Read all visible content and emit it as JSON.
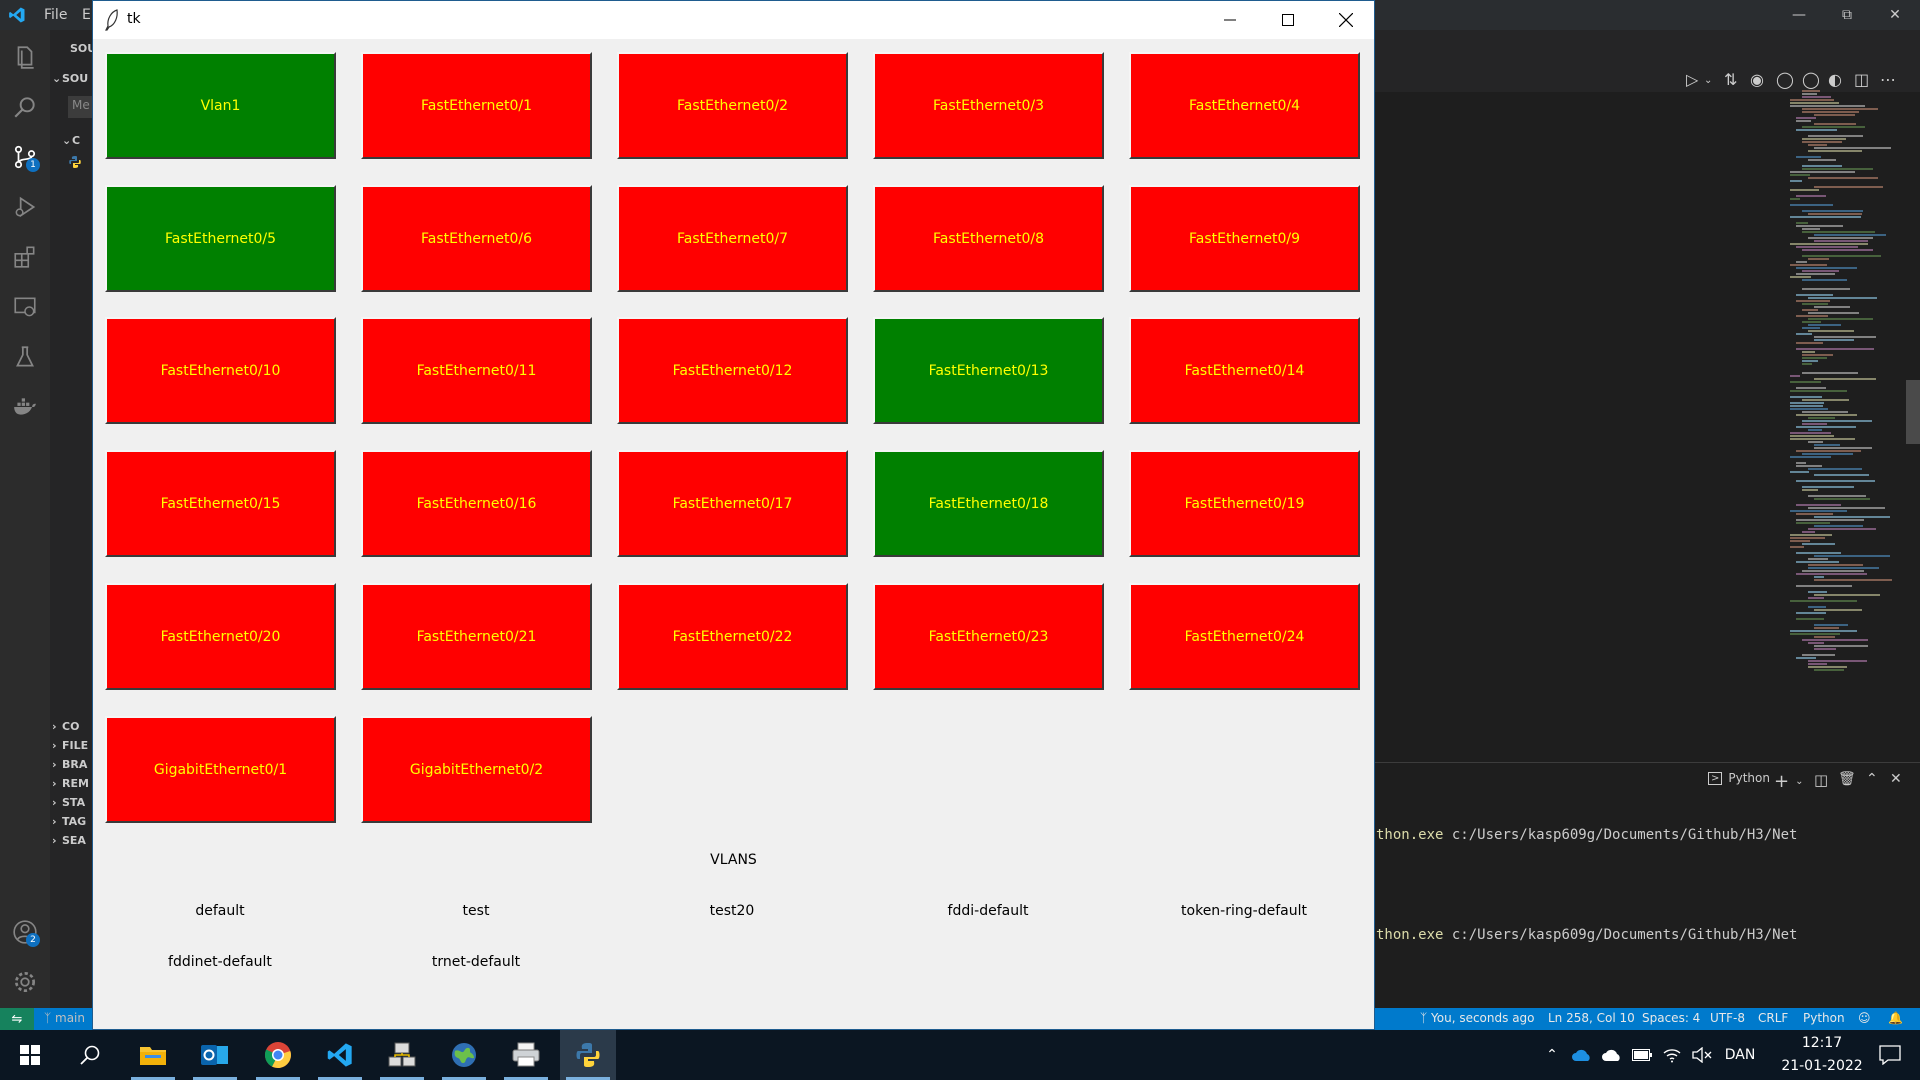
{
  "vscode": {
    "menu": [
      "File",
      "E"
    ],
    "sidebar": {
      "header": "SOU",
      "section": "SOU",
      "input_placeholder": "Me",
      "group": "C",
      "bottom_sections": [
        "CO",
        "FILE",
        "BRA",
        "REM",
        "STA",
        "TAG",
        "SEA"
      ]
    },
    "activity_badges": {
      "source_control": "1",
      "accounts": "2"
    },
    "terminal": {
      "shell_label": "Python",
      "lines": [
        {
          "exe": "thon.exe",
          "path": " c:/Users/kasp609g/Documents/Github/H3/Net"
        },
        {
          "exe": "thon.exe",
          "path": " c:/Users/kasp609g/Documents/Github/H3/Net"
        }
      ]
    },
    "statusbar": {
      "branch": "main",
      "blame": "You, seconds ago",
      "position": "Ln 258, Col 10",
      "spaces": "Spaces: 4",
      "encoding": "UTF-8",
      "eol": "CRLF",
      "language": "Python"
    }
  },
  "tk": {
    "title": "tk",
    "ports": [
      {
        "label": "Vlan1",
        "status": "up"
      },
      {
        "label": "FastEthernet0/1",
        "status": "down"
      },
      {
        "label": "FastEthernet0/2",
        "status": "down"
      },
      {
        "label": "FastEthernet0/3",
        "status": "down"
      },
      {
        "label": "FastEthernet0/4",
        "status": "down"
      },
      {
        "label": "FastEthernet0/5",
        "status": "up"
      },
      {
        "label": "FastEthernet0/6",
        "status": "down"
      },
      {
        "label": "FastEthernet0/7",
        "status": "down"
      },
      {
        "label": "FastEthernet0/8",
        "status": "down"
      },
      {
        "label": "FastEthernet0/9",
        "status": "down"
      },
      {
        "label": "FastEthernet0/10",
        "status": "down"
      },
      {
        "label": "FastEthernet0/11",
        "status": "down"
      },
      {
        "label": "FastEthernet0/12",
        "status": "down"
      },
      {
        "label": "FastEthernet0/13",
        "status": "up"
      },
      {
        "label": "FastEthernet0/14",
        "status": "down"
      },
      {
        "label": "FastEthernet0/15",
        "status": "down"
      },
      {
        "label": "FastEthernet0/16",
        "status": "down"
      },
      {
        "label": "FastEthernet0/17",
        "status": "down"
      },
      {
        "label": "FastEthernet0/18",
        "status": "up"
      },
      {
        "label": "FastEthernet0/19",
        "status": "down"
      },
      {
        "label": "FastEthernet0/20",
        "status": "down"
      },
      {
        "label": "FastEthernet0/21",
        "status": "down"
      },
      {
        "label": "FastEthernet0/22",
        "status": "down"
      },
      {
        "label": "FastEthernet0/23",
        "status": "down"
      },
      {
        "label": "FastEthernet0/24",
        "status": "down"
      },
      {
        "label": "GigabitEthernet0/1",
        "status": "down"
      },
      {
        "label": "GigabitEthernet0/2",
        "status": "down"
      }
    ],
    "vlans_title": "VLANS",
    "vlans": [
      "default",
      "test",
      "test20",
      "fddi-default",
      "token-ring-default",
      "fddinet-default",
      "trnet-default"
    ],
    "colors": {
      "up": "#008000",
      "down": "#ff0000",
      "label": "#ffff00"
    }
  },
  "taskbar": {
    "apps": [
      "start-icon",
      "search-icon",
      "file-explorer-icon",
      "outlook-icon",
      "chrome-icon",
      "vscode-icon",
      "network-tool-icon",
      "globe-icon",
      "printer-icon",
      "python-tk-icon"
    ],
    "language": "DAN",
    "time": "12:17",
    "date": "21-01-2022"
  }
}
